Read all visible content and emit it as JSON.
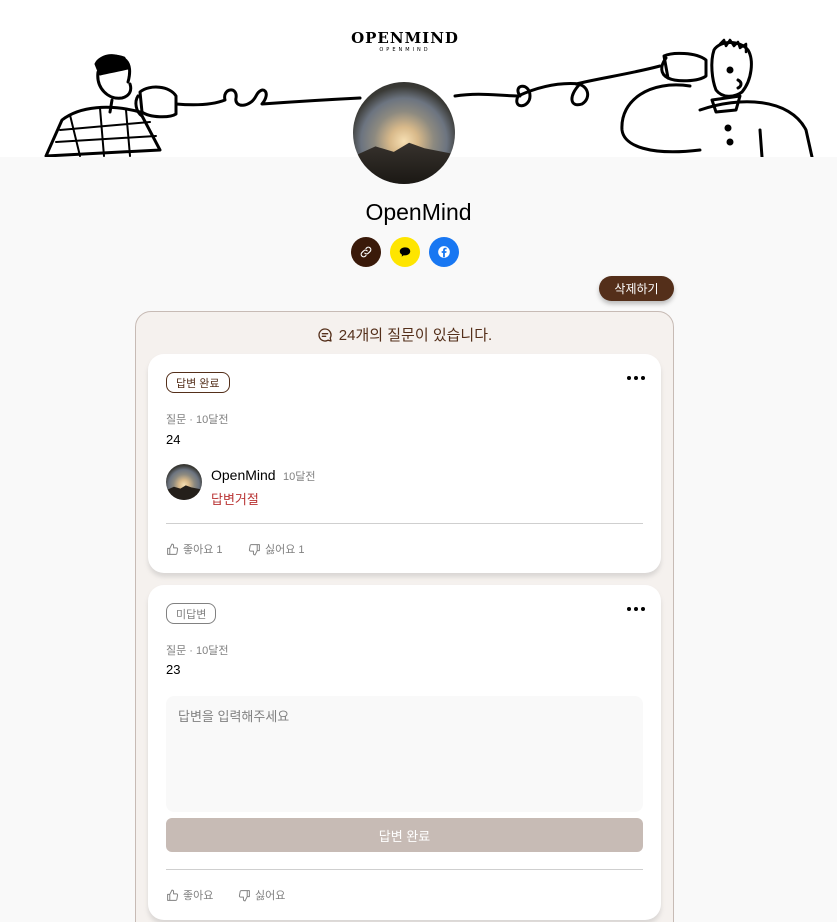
{
  "logo": {
    "main": "OPENMIND",
    "sub": "OPENMIND"
  },
  "profile": {
    "name": "OpenMind"
  },
  "share": {
    "link_icon": "link-icon",
    "kakao_icon": "kakaotalk-icon",
    "facebook_icon": "facebook-icon"
  },
  "actions": {
    "delete_label": "삭제하기"
  },
  "feed": {
    "count_text": "24개의 질문이 있습니다.",
    "questions": [
      {
        "status": "답변 완료",
        "meta": "질문 · 10달전",
        "content": "24",
        "answer": {
          "author": "OpenMind",
          "time": "10달전",
          "text": "답변거절"
        },
        "like_label": "좋아요 1",
        "dislike_label": "싫어요 1"
      },
      {
        "status": "미답변",
        "meta": "질문 · 10달전",
        "content": "23",
        "answer_placeholder": "답변을 입력해주세요",
        "submit_label": "답변 완료",
        "like_label": "좋아요",
        "dislike_label": "싫어요"
      }
    ]
  },
  "colors": {
    "brown": "#542f1a",
    "beige": "#f5f1ee",
    "border": "#c7bbb5",
    "kakao": "#fee500",
    "facebook": "#1877f2",
    "reject": "#b93333"
  }
}
